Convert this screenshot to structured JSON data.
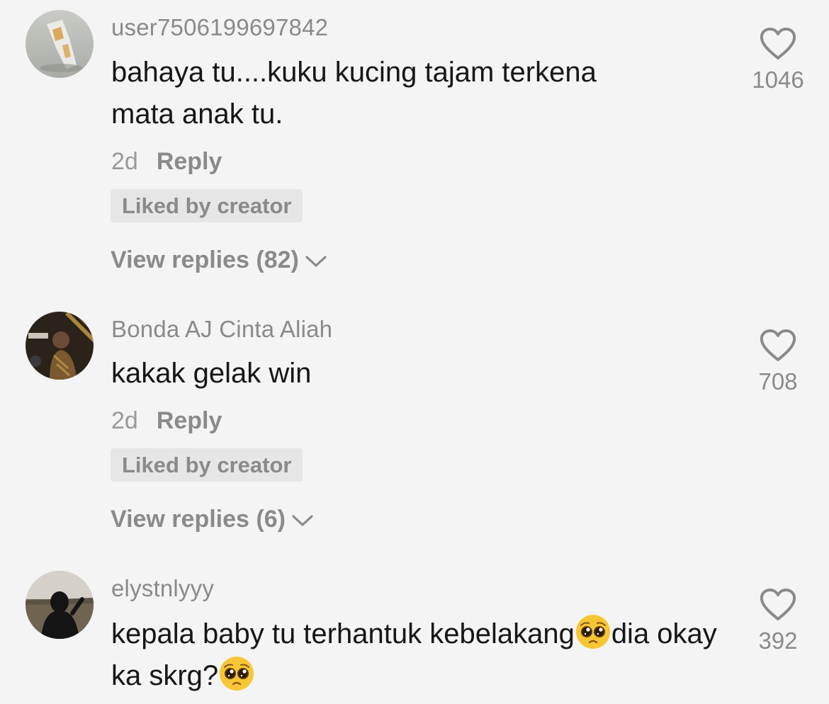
{
  "comments": [
    {
      "username": "user7506199697842",
      "text": "bahaya tu....kuku kucing tajam terkena mata anak tu.",
      "time": "2d",
      "reply_label": "Reply",
      "badge": "Liked by creator",
      "view_replies": "View replies (82)",
      "like_count": "1046"
    },
    {
      "username": "Bonda AJ Cinta Aliah",
      "text": "kakak gelak win",
      "time": "2d",
      "reply_label": "Reply",
      "badge": "Liked by creator",
      "view_replies": "View replies (6)",
      "like_count": "708"
    },
    {
      "username": "elystnlyyy",
      "text_part1": "kepala baby tu terhantuk kebelakang",
      "text_part2": "dia okay ka skrg?",
      "like_count": "392"
    }
  ],
  "icons": {
    "like": "heart-outline-icon",
    "expand": "chevron-down-icon",
    "emoji": "pleading-face-emoji"
  },
  "colors": {
    "background": "#f4f4f4",
    "text_primary": "#161616",
    "text_secondary": "#8a8a8a",
    "badge_bg": "#e6e6e6"
  }
}
